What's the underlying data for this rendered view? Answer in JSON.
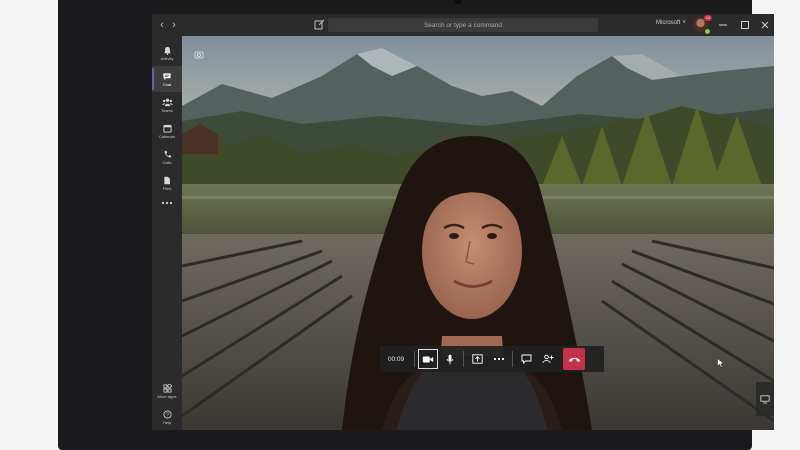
{
  "titlebar": {
    "search_placeholder": "Search or type a command",
    "tenant_name": "Microsoft",
    "notification_count": "10"
  },
  "rail": {
    "items": [
      {
        "label": "Activity",
        "icon": "bell-icon"
      },
      {
        "label": "Chat",
        "icon": "chat-icon"
      },
      {
        "label": "Teams",
        "icon": "teams-icon"
      },
      {
        "label": "Calendar",
        "icon": "calendar-icon"
      },
      {
        "label": "Calls",
        "icon": "phone-icon"
      },
      {
        "label": "Files",
        "icon": "file-icon"
      },
      {
        "label": "More apps",
        "icon": "apps-icon"
      },
      {
        "label": "Help",
        "icon": "help-icon"
      }
    ]
  },
  "call": {
    "timer": "00:09",
    "controls": [
      "video-camera",
      "microphone",
      "share-screen",
      "more-options",
      "chat",
      "participants",
      "hang-up"
    ],
    "hangup_color": "#c4314b"
  },
  "theme": {
    "accent": "#6264a7",
    "chrome": "#2b2b2b"
  }
}
